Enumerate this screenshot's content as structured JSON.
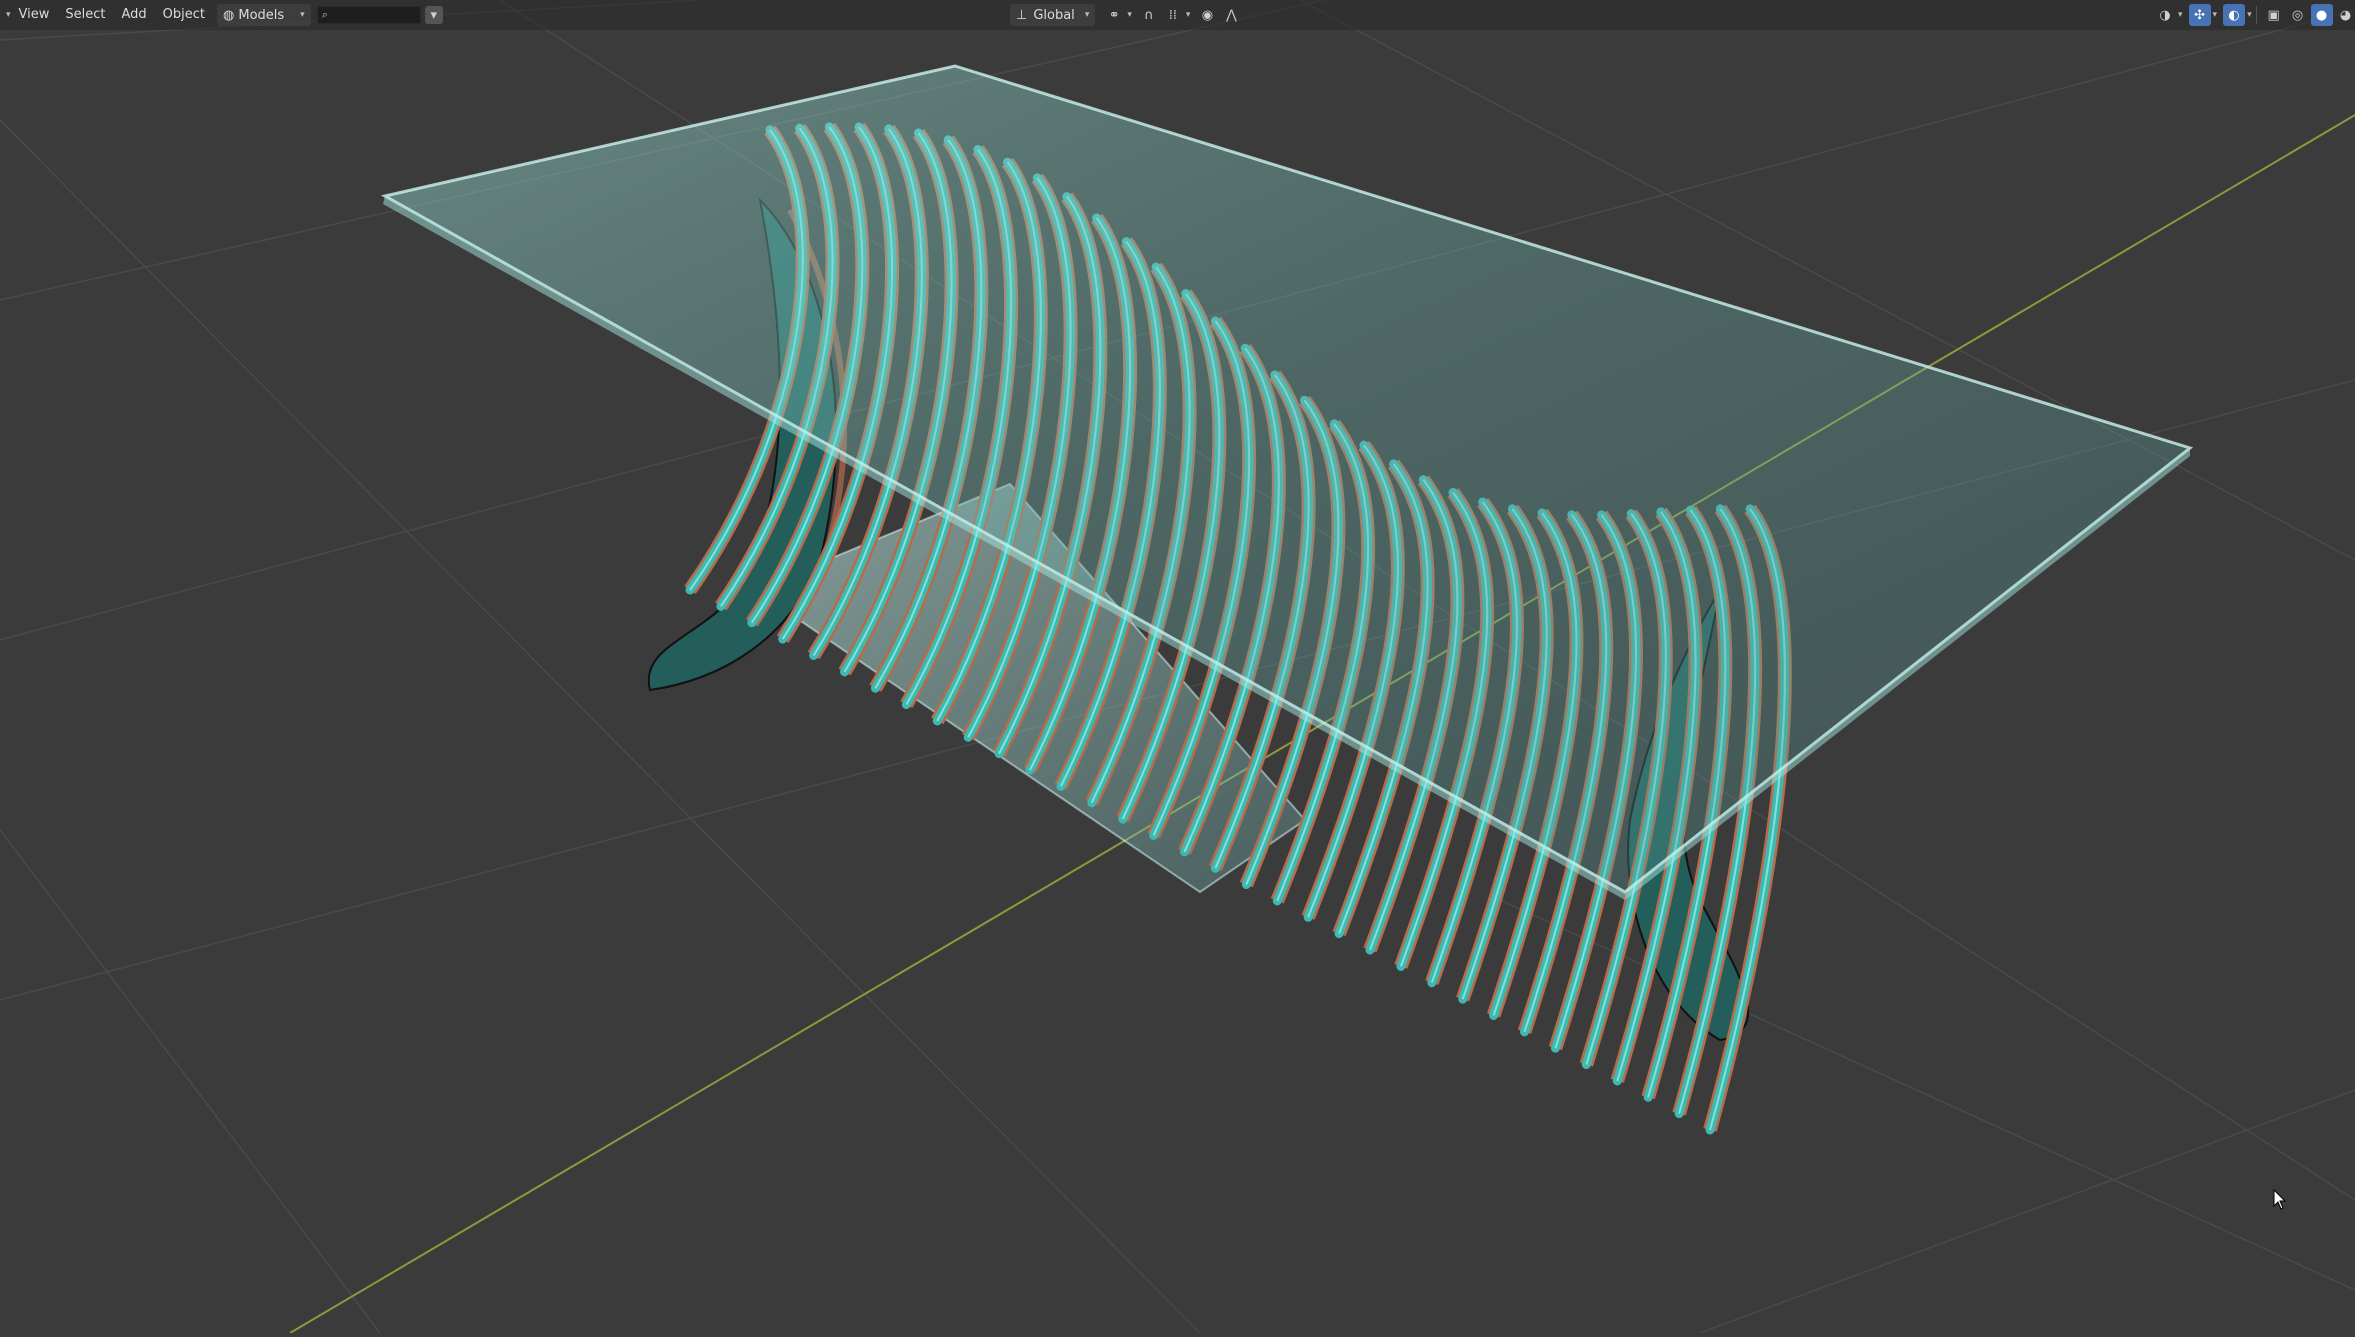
{
  "header": {
    "menus": [
      "View",
      "Select",
      "Add",
      "Object"
    ],
    "collection_dropdown": "Models",
    "search_placeholder": "",
    "transform_orientation": "Global"
  },
  "icons": {
    "collection": "world-sphere-icon",
    "search": "search-icon",
    "filter": "filter-icon",
    "orientation": "axis-icon",
    "pivot": "link-icon",
    "snap": "magnet-icon",
    "snap_target": "snap-grid-icon",
    "proportional": "proportional-edit-icon",
    "falloff": "falloff-curve-icon",
    "visibility": "eye-selectable-icon",
    "gizmo": "gizmo-icon",
    "overlays": "overlays-icon",
    "xray": "xray-icon",
    "shading_wire": "wireframe-shading-icon",
    "shading_solid": "solid-shading-icon",
    "shading_material": "material-preview-icon",
    "cursor": "mouse-cursor-icon"
  },
  "colors": {
    "background": "#3b3b3b",
    "grid": "#4d4d4d",
    "axis_x": "#8b9a3b",
    "glass": "#7fd6d0",
    "slat": "#3fb8b0",
    "slat_edge": "#b86a4a",
    "accent": "#4772b3"
  }
}
